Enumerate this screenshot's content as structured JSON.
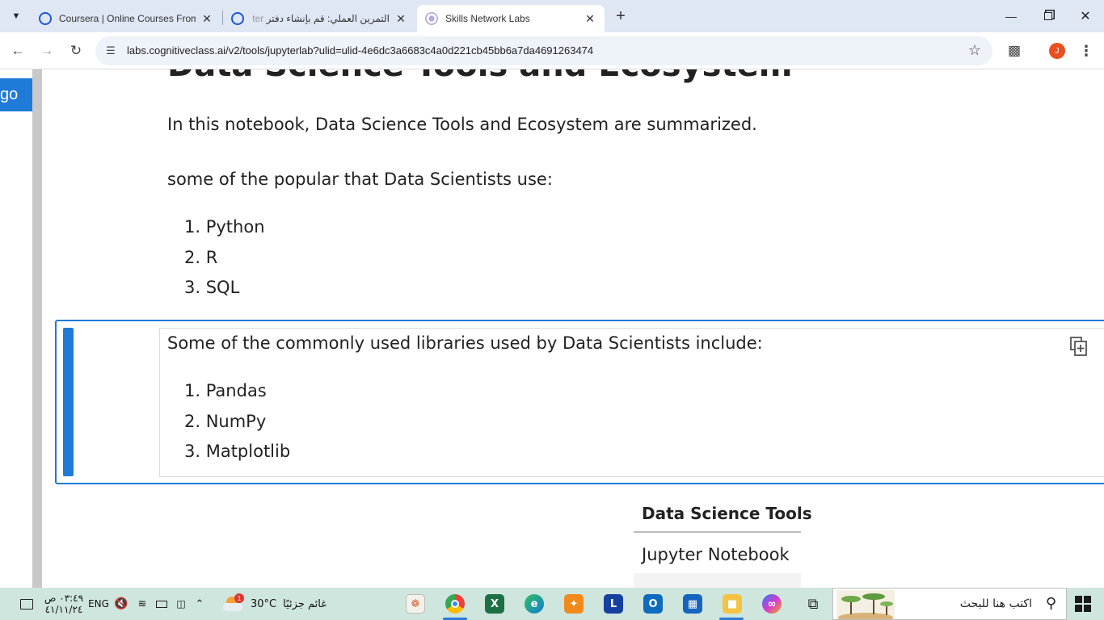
{
  "browser": {
    "tabs": [
      {
        "title": "Coursera | Online Courses From",
        "active": false
      },
      {
        "title": "التمرين العملي: قم بإنشاء دفتر",
        "title_faded_prefix": "ter",
        "active": false
      },
      {
        "title": "Skills Network Labs",
        "active": true
      }
    ],
    "new_tab_label": "+",
    "url": "labs.cognitiveclass.ai/v2/tools/jupyterlab?ulid=ulid-4e6dc3a6683c4a0d221cb45bb6a7da4691263474",
    "profile_initial": "J"
  },
  "page": {
    "go_button_label": "go",
    "heading_partial": "Data Science Tools and Ecosystem",
    "intro_text": "In this notebook, Data Science Tools and Ecosystem are summarized.",
    "languages_intro": "some of the popular that Data Scientists use:",
    "languages": [
      "1. Python",
      "2. R",
      "3. SQL"
    ],
    "libraries_intro": "Some of the commonly used libraries used by Data Scientists include:",
    "libraries": [
      "1. Pandas",
      "2. NumPy",
      "3. Matplotlib"
    ],
    "tools_table": {
      "header": "Data Science Tools",
      "rows": [
        "Jupyter Notebook"
      ]
    }
  },
  "taskbar": {
    "time": "٠٣:٤٩ ص",
    "date": "٤١/١١/٢٤",
    "language": "ENG",
    "temperature": "30°C",
    "weather_text": "غائم جزئيًا",
    "weather_badge": "1",
    "search_placeholder": "اكتب هنا للبحث",
    "apps": [
      "paint-icon",
      "chrome-icon",
      "excel-icon",
      "edge-icon",
      "app-orange-icon",
      "app-l-icon",
      "outlook-icon",
      "store-icon",
      "file-explorer-icon",
      "copilot-icon",
      "task-view-icon"
    ]
  },
  "colors": {
    "accent_blue": "#1f7ad8",
    "tabstrip_bg": "#dfe7f5",
    "taskbar_bg": "#cfe6de"
  }
}
